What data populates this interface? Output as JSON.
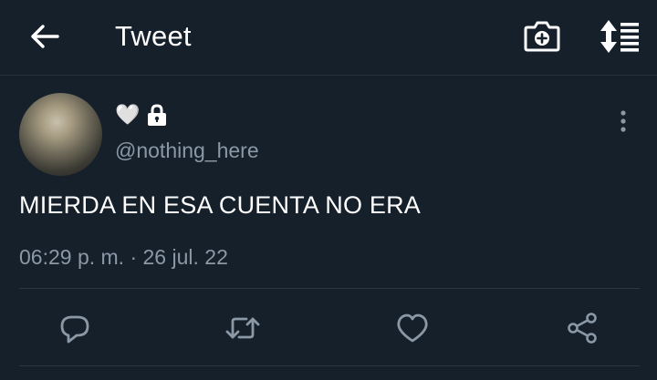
{
  "header": {
    "title": "Tweet",
    "back_icon": "arrow-left-icon",
    "camera_icon": "camera-plus-icon",
    "sort_icon": "sort-list-icon"
  },
  "tweet": {
    "display_name": "🤍",
    "protected_icon": "lock-icon",
    "handle": "@nothing_here",
    "text": "MIERDA EN ESA CUENTA NO ERA",
    "timestamp": "06:29 p. m. · 26 jul. 22"
  },
  "actions": {
    "reply_icon": "reply-icon",
    "retweet_icon": "retweet-icon",
    "like_icon": "heart-icon",
    "share_icon": "share-icon"
  },
  "colors": {
    "background": "#15202b",
    "secondary_text": "#8b98a5",
    "divider": "#2b3742"
  }
}
